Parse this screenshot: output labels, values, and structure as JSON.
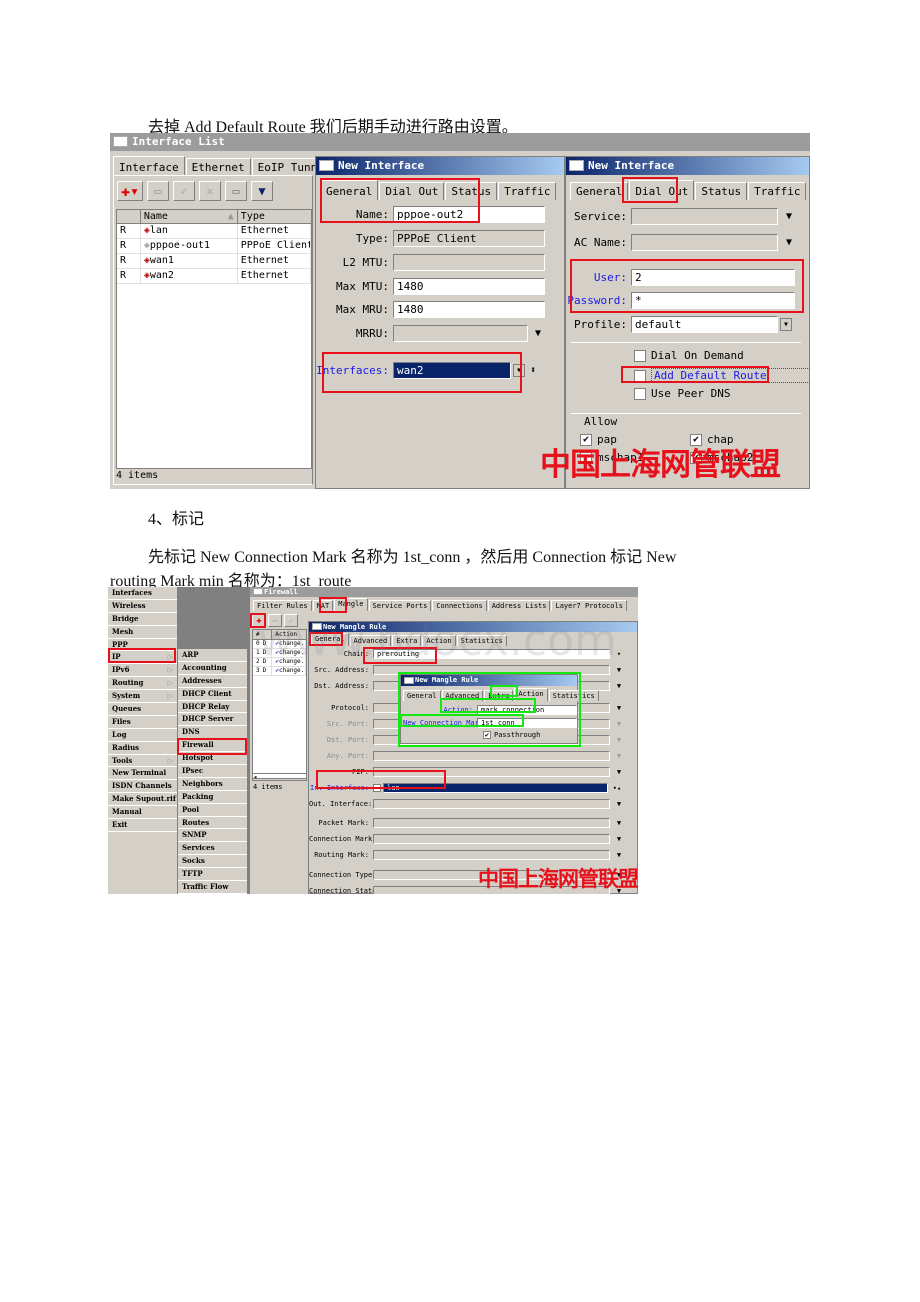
{
  "paragraphs": {
    "p1": "去掉 Add Default Route 我们后期手动进行路由设置。",
    "p2": "4、标记",
    "p3_line1": "先标记 New Connection Mark 名称为 1st_conn ，然后用 Connection 标记 New",
    "p3_line2": "routing Mark min 名称为：1st_route"
  },
  "watermark": "中国上海网管联盟",
  "site_watermark": "www.bdocx.com",
  "interface_list": {
    "title": "Interface List",
    "tabs": [
      "Interface",
      "Ethernet",
      "EoIP Tunnel"
    ],
    "toolbar": [
      "add-icon",
      "remove-icon",
      "enable-icon",
      "disable-icon",
      "comment-icon",
      "filter-icon"
    ],
    "columns": [
      "",
      "Name",
      "Type"
    ],
    "rows": [
      {
        "flag": "R",
        "name": "lan",
        "type": "Ethernet",
        "icon": "ethernet-icon"
      },
      {
        "flag": "R",
        "name": "pppoe-out1",
        "type": "PPPoE Client",
        "icon": "pppoe-icon"
      },
      {
        "flag": "R",
        "name": "wan1",
        "type": "Ethernet",
        "icon": "ethernet-icon"
      },
      {
        "flag": "R",
        "name": "wan2",
        "type": "Ethernet",
        "icon": "ethernet-icon"
      }
    ],
    "status": "4 items"
  },
  "new_interface_general": {
    "title": "New Interface",
    "tabs": [
      "General",
      "Dial Out",
      "Status",
      "Traffic"
    ],
    "fields": {
      "name_label": "Name:",
      "name_value": "pppoe-out2",
      "type_label": "Type:",
      "type_value": "PPPoE Client",
      "l2mtu_label": "L2 MTU:",
      "l2mtu_value": "",
      "maxmtu_label": "Max MTU:",
      "maxmtu_value": "1480",
      "maxmru_label": "Max MRU:",
      "maxmru_value": "1480",
      "mrru_label": "MRRU:",
      "mrru_value": "",
      "interfaces_label": "Interfaces:",
      "interfaces_value": "wan2"
    }
  },
  "new_interface_dialout": {
    "title": "New Interface",
    "tabs": [
      "General",
      "Dial Out",
      "Status",
      "Traffic"
    ],
    "fields": {
      "service_label": "Service:",
      "service_value": "",
      "acname_label": "AC Name:",
      "acname_value": "",
      "user_label": "User:",
      "user_value": "2",
      "password_label": "Password:",
      "password_value": "*",
      "profile_label": "Profile:",
      "profile_value": "default"
    },
    "checkboxes": [
      {
        "label": "Dial On Demand",
        "checked": false
      },
      {
        "label": "Add Default Route",
        "checked": false
      },
      {
        "label": "Use Peer DNS",
        "checked": false
      }
    ],
    "allow_label": "Allow",
    "allow": [
      {
        "label": "pap",
        "checked": true
      },
      {
        "label": "chap",
        "checked": true
      },
      {
        "label": "mschap1",
        "checked": false
      },
      {
        "label": "mschap2",
        "checked": true
      }
    ]
  },
  "main_menu": {
    "items": [
      {
        "label": "Interfaces",
        "sub": false
      },
      {
        "label": "Wireless",
        "sub": false
      },
      {
        "label": "Bridge",
        "sub": false
      },
      {
        "label": "Mesh",
        "sub": false
      },
      {
        "label": "PPP",
        "sub": false
      },
      {
        "label": "IP",
        "sub": true
      },
      {
        "label": "IPv6",
        "sub": true
      },
      {
        "label": "Routing",
        "sub": true
      },
      {
        "label": "System",
        "sub": true
      },
      {
        "label": "Queues",
        "sub": false
      },
      {
        "label": "Files",
        "sub": false
      },
      {
        "label": "Log",
        "sub": false
      },
      {
        "label": "Radius",
        "sub": false
      },
      {
        "label": "Tools",
        "sub": true
      },
      {
        "label": "New Terminal",
        "sub": false
      },
      {
        "label": "ISDN Channels",
        "sub": false
      },
      {
        "label": "Make Supout.rif",
        "sub": false
      },
      {
        "label": "Manual",
        "sub": false
      },
      {
        "label": "Exit",
        "sub": false
      }
    ]
  },
  "ip_submenu": {
    "items": [
      "ARP",
      "Accounting",
      "Addresses",
      "DHCP Client",
      "DHCP Relay",
      "DHCP Server",
      "DNS",
      "Firewall",
      "Hotspot",
      "IPsec",
      "Neighbors",
      "Packing",
      "Pool",
      "Routes",
      "SNMP",
      "Services",
      "Socks",
      "TFTP",
      "Traffic Flow"
    ]
  },
  "firewall": {
    "title": "Firewall",
    "tabs": [
      "Filter Rules",
      "NAT",
      "Mangle",
      "Service Ports",
      "Connections",
      "Address Lists",
      "Layer7 Protocols"
    ],
    "columns": [
      "#",
      "Action"
    ],
    "rows": [
      {
        "num": "0",
        "flag": "D",
        "action": "change..."
      },
      {
        "num": "1",
        "flag": "D",
        "action": "change..."
      },
      {
        "num": "2",
        "flag": "D",
        "action": "change..."
      },
      {
        "num": "3",
        "flag": "D",
        "action": "change..."
      }
    ],
    "status": "4 items"
  },
  "mangle_general": {
    "title": "New Mangle Rule",
    "tabs": [
      "General",
      "Advanced",
      "Extra",
      "Action",
      "Statistics"
    ],
    "fields": [
      {
        "label": "Chain:",
        "value": "prerouting",
        "style": "normal"
      },
      {
        "label": "Src. Address:",
        "value": "",
        "style": "normal"
      },
      {
        "label": "Dst. Address:",
        "value": "",
        "style": "normal"
      },
      {
        "label": "Protocol:",
        "value": "",
        "style": "normal"
      },
      {
        "label": "Src. Port:",
        "value": "",
        "style": "grayed"
      },
      {
        "label": "Dst. Port:",
        "value": "",
        "style": "grayed"
      },
      {
        "label": "Any. Port:",
        "value": "",
        "style": "grayed"
      },
      {
        "label": "P2P:",
        "value": "",
        "style": "normal"
      },
      {
        "label": "In. Interface:",
        "value": "lan",
        "style": "blue"
      },
      {
        "label": "Out. Interface:",
        "value": "",
        "style": "normal"
      },
      {
        "label": "Packet Mark:",
        "value": "",
        "style": "normal"
      },
      {
        "label": "Connection Mark:",
        "value": "",
        "style": "normal"
      },
      {
        "label": "Routing Mark:",
        "value": "",
        "style": "normal"
      },
      {
        "label": "Connection Type:",
        "value": "",
        "style": "normal"
      },
      {
        "label": "Connection State:",
        "value": "",
        "style": "normal"
      }
    ]
  },
  "mangle_action": {
    "title": "New Mangle Rule",
    "tabs": [
      "General",
      "Advanced",
      "Extra",
      "Action",
      "Statistics"
    ],
    "action_label": "Action:",
    "action_value": "mark connection",
    "mark_label": "New Connection Mark:",
    "mark_value": "1st_conn",
    "passthrough_label": "Passthrough",
    "passthrough_checked": true
  },
  "colors": {
    "highlight_red": "#e8101a",
    "highlight_green": "#12e812",
    "titlebar": "#0a246a",
    "selection": "#0a246a",
    "window_bg": "#d4d0c8"
  }
}
